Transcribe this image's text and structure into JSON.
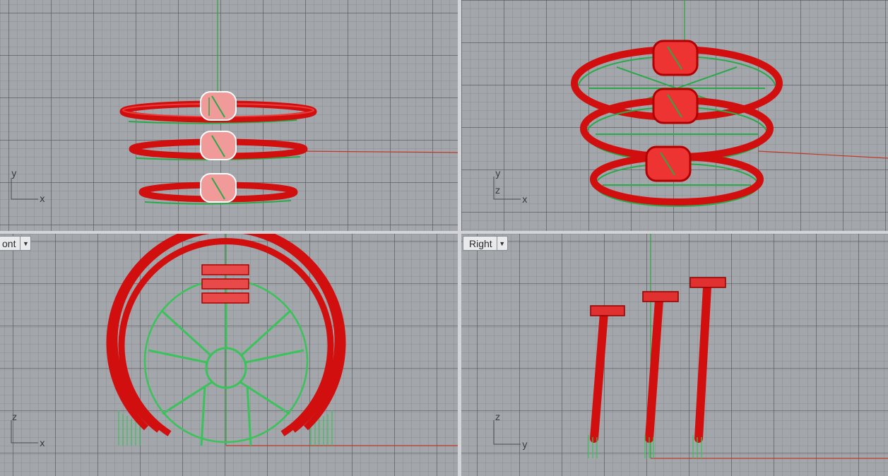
{
  "viewports": {
    "top": {
      "axes": {
        "vertical": "y",
        "horizontal": "x"
      }
    },
    "perspective": {
      "axes": {
        "vertical": "y",
        "depth": "z",
        "horizontal": "x"
      }
    },
    "front": {
      "label": "ont",
      "axes": {
        "vertical": "z",
        "horizontal": "x"
      }
    },
    "right": {
      "label": "Right",
      "axes": {
        "vertical": "z",
        "horizontal": "y"
      }
    }
  },
  "icons": {
    "viewport_menu": "chevron-down-icon"
  },
  "colors": {
    "grid_bg": "#a3a6ab",
    "model_red": "#e01010",
    "support_green": "#39c35a",
    "axis_x": "#c0392b",
    "axis_y": "#2fa33c"
  }
}
